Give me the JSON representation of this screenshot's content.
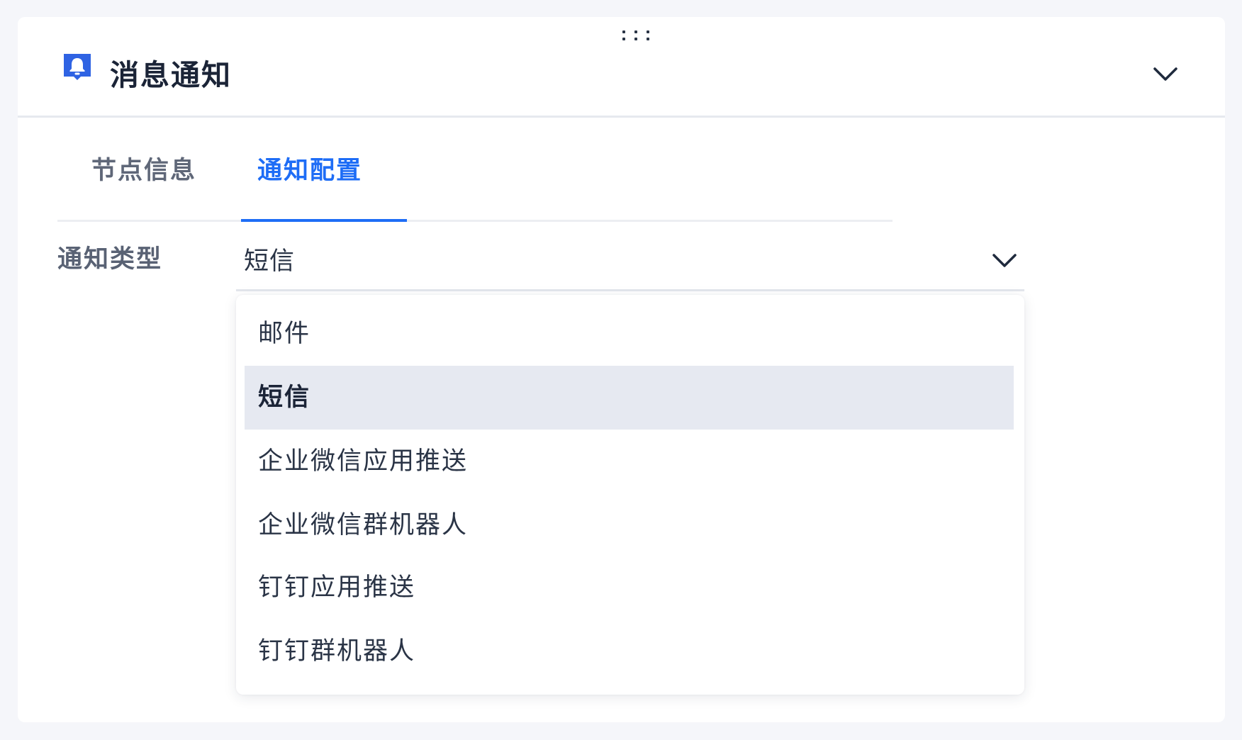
{
  "panel": {
    "title": "消息通知",
    "icon": "bell-icon",
    "accent_color": "#2f63e3"
  },
  "tabs": [
    {
      "label": "节点信息",
      "active": false
    },
    {
      "label": "通知配置",
      "active": true
    }
  ],
  "form": {
    "notification_type": {
      "label": "通知类型",
      "value": "短信",
      "options": [
        {
          "label": "邮件",
          "selected": false
        },
        {
          "label": "短信",
          "selected": true
        },
        {
          "label": "企业微信应用推送",
          "selected": false
        },
        {
          "label": "企业微信群机器人",
          "selected": false
        },
        {
          "label": "钉钉应用推送",
          "selected": false
        },
        {
          "label": "钉钉群机器人",
          "selected": false
        }
      ]
    }
  },
  "colors": {
    "active_tab": "#1e6df6",
    "selected_option_bg": "#e6e9f1",
    "text": "#2a3446"
  }
}
